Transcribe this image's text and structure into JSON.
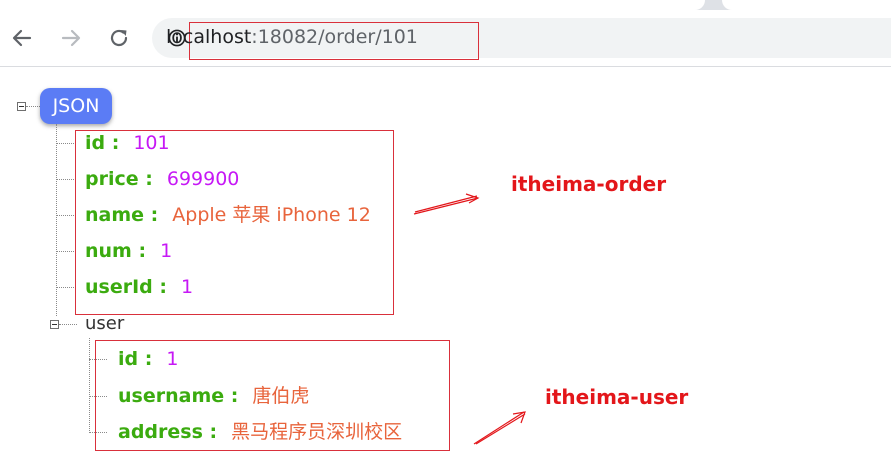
{
  "browser": {
    "url_host": "localhost",
    "url_rest": ":18082/order/101"
  },
  "json_view": {
    "root_label": "JSON",
    "fields": [
      {
        "key": "id",
        "value": "101",
        "type": "number"
      },
      {
        "key": "price",
        "value": "699900",
        "type": "number"
      },
      {
        "key": "name",
        "value": "Apple 苹果 iPhone 12",
        "type": "string"
      },
      {
        "key": "num",
        "value": "1",
        "type": "number"
      },
      {
        "key": "userId",
        "value": "1",
        "type": "number"
      }
    ],
    "user_label": "user",
    "user_fields": [
      {
        "key": "id",
        "value": "1",
        "type": "number"
      },
      {
        "key": "username",
        "value": "唐伯虎",
        "type": "string"
      },
      {
        "key": "address",
        "value": "黑马程序员深圳校区",
        "type": "string"
      }
    ]
  },
  "annotations": {
    "order_service": "itheima-order",
    "user_service": "itheima-user"
  },
  "colors": {
    "key": "#3bab0f",
    "number": "#c618f5",
    "string": "#e8643c",
    "badge": "#5b7cf5",
    "annotation": "#e3161a"
  }
}
